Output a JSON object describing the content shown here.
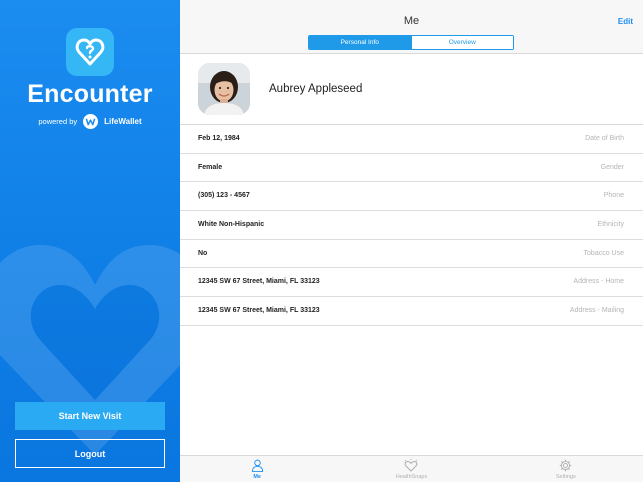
{
  "sidebar": {
    "app_name": "Encounter",
    "powered_by": "powered by",
    "partner_name": "LifeWallet",
    "start_visit_label": "Start New Visit",
    "logout_label": "Logout",
    "accent_color": "#1b8cf0"
  },
  "header": {
    "title": "Me",
    "edit_label": "Edit",
    "segments": [
      {
        "label": "Personal Info",
        "selected": true
      },
      {
        "label": "Overview",
        "selected": false
      }
    ]
  },
  "profile": {
    "name": "Aubrey Appleseed",
    "avatar_icon": "user-photo"
  },
  "fields": [
    {
      "value": "Feb 12, 1984",
      "label": "Date of Birth"
    },
    {
      "value": "Female",
      "label": "Gender"
    },
    {
      "value": "(305) 123 - 4567",
      "label": "Phone"
    },
    {
      "value": "White Non-Hispanic",
      "label": "Ethnicity"
    },
    {
      "value": "No",
      "label": "Tobacco Use"
    },
    {
      "value": "12345 SW 67 Street, Miami, FL 33123",
      "label": "Address - Home"
    },
    {
      "value": "12345 SW 67 Street, Miami, FL 33123",
      "label": "Address - Mailing"
    }
  ],
  "tabs": [
    {
      "label": "Me",
      "icon": "person-icon",
      "active": true
    },
    {
      "label": "HealthSnaps",
      "icon": "heart-sparkle-icon",
      "active": false
    },
    {
      "label": "Settings",
      "icon": "gear-icon",
      "active": false
    }
  ]
}
